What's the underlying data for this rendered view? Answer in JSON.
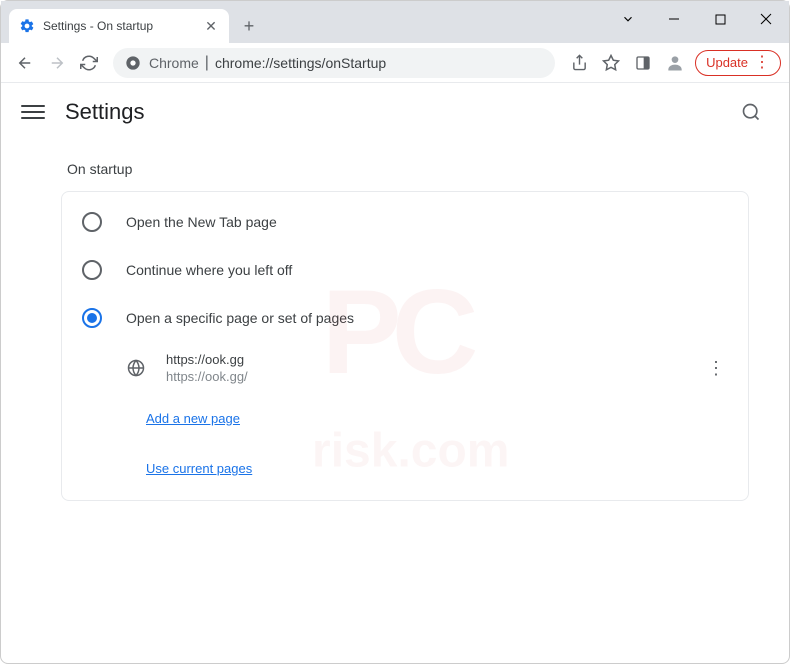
{
  "tab": {
    "title": "Settings - On startup"
  },
  "address": {
    "site": "Chrome",
    "url": "chrome://settings/onStartup"
  },
  "toolbar": {
    "update_label": "Update"
  },
  "header": {
    "title": "Settings"
  },
  "section": {
    "title": "On startup"
  },
  "options": {
    "opt1": "Open the New Tab page",
    "opt2": "Continue where you left off",
    "opt3": "Open a specific page or set of pages"
  },
  "startup_page": {
    "title": "https://ook.gg",
    "url": "https://ook.gg/"
  },
  "links": {
    "add": "Add a new page",
    "use_current": "Use current pages"
  }
}
